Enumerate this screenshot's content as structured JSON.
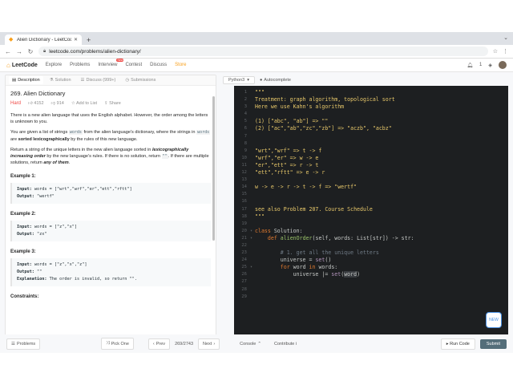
{
  "browser": {
    "tab_title": "Alien Dictionary - LeetCode",
    "url": "leetcode.com/problems/alien-dictionary/"
  },
  "nav": {
    "logo": "LeetCode",
    "items": [
      "Explore",
      "Problems",
      "Interview",
      "Contest",
      "Discuss",
      "Store"
    ],
    "interview_badge": "New",
    "notifications": "1"
  },
  "left_tabs": [
    {
      "label": "Description"
    },
    {
      "label": "Solution"
    },
    {
      "label": "Discuss (999+)"
    },
    {
      "label": "Submissions"
    }
  ],
  "problem": {
    "title": "269. Alien Dictionary",
    "difficulty": "Hard",
    "likes": "4152",
    "dislikes": "914",
    "add_to_list": "Add to List",
    "share": "Share",
    "p1": "There is a new alien language that uses the English alphabet. However, the order among the letters is unknown to you.",
    "p2a": "You are given a list of strings ",
    "p2code": "words",
    "p2b": " from the alien language's dictionary, where the strings in ",
    "p2code2": "words",
    "p2c": " are ",
    "p2bold": "sorted lexicographically",
    "p2d": " by the rules of this new language.",
    "p3a": "Return a string of the unique letters in the new alien language sorted in ",
    "p3bold": "lexicographically increasing order",
    "p3b": " by the new language's rules. If there is no solution, return ",
    "p3code": "\"\"",
    "p3c": ". If there are multiple solutions, return ",
    "p3bold2": "any of them",
    "p3d": ".",
    "examples": [
      {
        "heading": "Example 1:",
        "input": "words = [\"wrt\",\"wrf\",\"er\",\"ett\",\"rftt\"]",
        "output": "\"wertf\"",
        "explanation": ""
      },
      {
        "heading": "Example 2:",
        "input": "words = [\"z\",\"x\"]",
        "output": "\"zx\"",
        "explanation": ""
      },
      {
        "heading": "Example 3:",
        "input": "words = [\"z\",\"x\",\"z\"]",
        "output": "\"\"",
        "explanation": "The order is invalid, so return \"\"."
      }
    ],
    "labels": {
      "input": "Input:",
      "output": "Output:",
      "explanation": "Explanation:"
    },
    "constraints": "Constraints:"
  },
  "editor": {
    "language": "Python3",
    "autocomplete": "Autocomplete",
    "lines": [
      "\"\"\"",
      "Treatment: graph algorithm, topological sort",
      "Here we use Kahn's algorithm",
      "",
      "(1) [\"abc\", \"ab\"] => \"\"",
      "(2) [\"ac\",\"ab\",\"zc\",\"zb\"] => \"aczb\", \"acbz\"",
      "",
      "",
      "\"wrt\",\"wrf\" => t -> f",
      "\"wrf\",\"er\" => w -> e",
      "\"er\",\"ett\" => r -> t",
      "\"ett\",\"rftt\" => e -> r",
      "",
      "w -> e -> r -> t -> f => \"wertf\"",
      "",
      "",
      "see also Problem 207. Course Schedule",
      "\"\"\"",
      "",
      "class Solution:",
      "    def alienOrder(self, words: List[str]) -> str:",
      "",
      "        # 1. get all the unique letters",
      "        universe = set()",
      "        for word in words:",
      "            universe |= set(word)",
      "",
      "",
      "29"
    ],
    "new_label": "NEW"
  },
  "footer": {
    "problems": "Problems",
    "pick_one": "Pick One",
    "prev": "Prev",
    "page": "269/2743",
    "next": "Next",
    "console": "Console",
    "contribute": "Contribute i",
    "run_code": "Run Code",
    "submit": "Submit"
  }
}
